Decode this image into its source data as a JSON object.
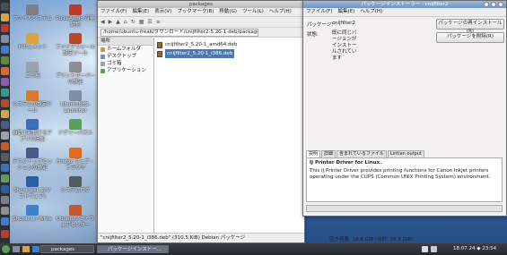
{
  "desktop_icons": [
    {
      "label": "ファイルシステム",
      "icon": "drive-icon",
      "color": "#7a7f88"
    },
    {
      "label": "PulseAudio 音量調整",
      "icon": "speaker-icon",
      "color": "#c0392b"
    },
    {
      "label": "ドキュメント",
      "icon": "folder-icon",
      "color": "#d9a440"
    },
    {
      "label": "ファイアウォール設定ツール",
      "icon": "firewall-icon",
      "color": "#b84a2a"
    },
    {
      "label": "ゴミ箱",
      "icon": "trash-icon",
      "color": "#9aa2ad"
    },
    {
      "label": "プリントサーバーの設定",
      "icon": "printer-icon",
      "color": "#8e8e8e"
    },
    {
      "label": "システムの設定ツール",
      "icon": "settings-icon",
      "color": "#d97b2a"
    },
    {
      "label": "UbuntuBBS-Launcher",
      "icon": "launcher-icon",
      "color": "#7f8fa6"
    },
    {
      "label": "自動で起動するアプリの追加",
      "icon": "autostart-icon",
      "color": "#3d6fbf"
    },
    {
      "label": "ジグソーパズル",
      "icon": "puzzle-icon",
      "color": "#5aa05a"
    },
    {
      "label": "デスクトップセッションの設定",
      "icon": "session-icon",
      "color": "#4a5a8a"
    },
    {
      "label": "Firefox ウェブ・ブラウザ",
      "icon": "firefox-icon",
      "color": "#e06a1f"
    },
    {
      "label": "ShowDesk 2(ソフトウェア)",
      "icon": "showdesk-icon",
      "color": "#2a5fa8"
    },
    {
      "label": "システムログ",
      "icon": "log-icon",
      "color": "#555b63"
    },
    {
      "label": "Shutdown Write",
      "icon": "shutdown-icon",
      "color": "#3a7fd0"
    },
    {
      "label": "Ubuntuソフトウェアセンター",
      "icon": "softwarecenter-icon",
      "color": "#c45a2a"
    }
  ],
  "file_manager": {
    "title": "packages",
    "menu": [
      "ファイル(F)",
      "編集(E)",
      "表示(V)",
      "ブックマーク(B)",
      "移動(G)",
      "ツール(L)",
      "ヘルプ(H)"
    ],
    "location": "/home/ubuntu-freak/ダウンロード/cnijfilter2-5.20-1-deb/packages",
    "sidebar_header": "場所",
    "sidebar_items": [
      "ホームフォルダ",
      "デスクトップ",
      "ゴミ箱",
      "アプリケーション"
    ],
    "files": [
      "cnijfilter2_5.20-1_amd64.deb",
      "cnijfilter2_5.20-1_i386.deb"
    ],
    "selected_index": 1,
    "status_left": "\"cnijfilter2_5.20-1_i386.deb\" (310.5 KiB) Debian パッケージ",
    "status_right": "空き容量: 18.8 GiB (合計: 26.5 GiB)"
  },
  "installer": {
    "title": "パッケージインストーラー - cnijfilter2",
    "menu": [
      "ファイル(F)",
      "編集(E)",
      "ヘルプ(H)"
    ],
    "package_label": "パッケージ:",
    "package_value": "cnijfilter2",
    "status_label": "状態:",
    "status_value": "既に同じバージョンがインストールされています",
    "reinstall_button": "パッケージの再インストール(R)",
    "remove_button": "パッケージを削除(R)",
    "tabs": [
      "説明",
      "詳細",
      "含まれているファイル",
      "Lintian output"
    ],
    "desc_title": "IJ Printer Driver for Linux.",
    "desc_body": "This IJ Printer Driver provides printing functions for Canon Inkjet printers operating under the CUPS (Common UNIX Printing System) environment."
  },
  "taskbar": {
    "items": [
      "packages",
      "パッケージインストー..."
    ],
    "clock": "18.07.24 ◆ 23:54"
  },
  "colors": {
    "accent": "#4a78b5",
    "titlebar_active": "#6c93c7"
  }
}
